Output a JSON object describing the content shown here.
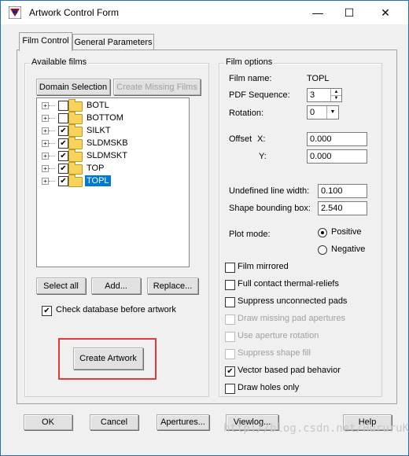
{
  "window": {
    "title": "Artwork Control Form",
    "minimize": "—",
    "maximize": "☐",
    "close": "✕"
  },
  "tabs": [
    {
      "label": "Film Control",
      "active": true
    },
    {
      "label": "General Parameters",
      "active": false
    }
  ],
  "available_films": {
    "legend": "Available films",
    "domain_selection": "Domain Selection",
    "create_missing_films": "Create Missing Films",
    "films": [
      {
        "name": "BOTL",
        "checked": false,
        "selected": false
      },
      {
        "name": "BOTTOM",
        "checked": false,
        "selected": false
      },
      {
        "name": "SILKT",
        "checked": true,
        "selected": false
      },
      {
        "name": "SLDMSKB",
        "checked": true,
        "selected": false
      },
      {
        "name": "SLDMSKT",
        "checked": true,
        "selected": false
      },
      {
        "name": "TOP",
        "checked": true,
        "selected": false
      },
      {
        "name": "TOPL",
        "checked": true,
        "selected": true
      }
    ],
    "select_all": "Select all",
    "add": "Add...",
    "replace": "Replace...",
    "check_database": {
      "label": "Check database before artwork",
      "checked": true
    },
    "create_artwork": "Create Artwork"
  },
  "film_options": {
    "legend": "Film options",
    "film_name_label": "Film name:",
    "film_name_value": "TOPL",
    "pdf_sequence_label": "PDF Sequence:",
    "pdf_sequence_value": "3",
    "rotation_label": "Rotation:",
    "rotation_value": "0",
    "offset_label": "Offset",
    "offset_x_label": "X:",
    "offset_x_value": "0.000",
    "offset_y_label": "Y:",
    "offset_y_value": "0.000",
    "undefined_line_width_label": "Undefined line width:",
    "undefined_line_width_value": "0.100",
    "shape_bounding_box_label": "Shape bounding box:",
    "shape_bounding_box_value": "2.540",
    "plot_mode_label": "Plot mode:",
    "plot_mode_positive": "Positive",
    "plot_mode_negative": "Negative",
    "plot_mode_selected": "Positive",
    "options": [
      {
        "label": "Film mirrored",
        "checked": false,
        "enabled": true
      },
      {
        "label": "Full contact thermal-reliefs",
        "checked": false,
        "enabled": true
      },
      {
        "label": "Suppress unconnected pads",
        "checked": false,
        "enabled": true
      },
      {
        "label": "Draw missing pad apertures",
        "checked": false,
        "enabled": false
      },
      {
        "label": "Use aperture rotation",
        "checked": false,
        "enabled": false
      },
      {
        "label": "Suppress shape fill",
        "checked": false,
        "enabled": false
      },
      {
        "label": "Vector based pad behavior",
        "checked": true,
        "enabled": true
      },
      {
        "label": "Draw holes only",
        "checked": false,
        "enabled": true
      }
    ]
  },
  "footer": {
    "ok": "OK",
    "cancel": "Cancel",
    "apertures": "Apertures...",
    "viewlog": "Viewlog...",
    "help": "Help"
  },
  "watermark": "http://blog.csdn.net/HururuKun",
  "colors": {
    "selection": "#0078d7",
    "highlight_box": "#e03a3a",
    "window_border": "#1f6fc0"
  }
}
